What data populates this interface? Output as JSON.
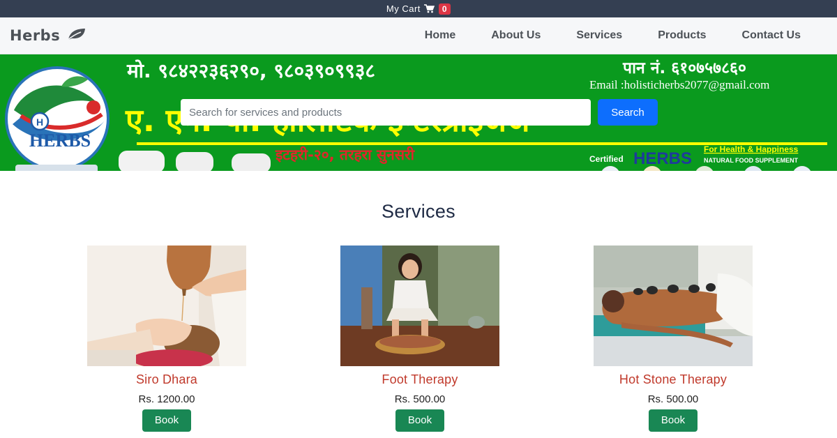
{
  "topbar": {
    "cart_label": "My Cart",
    "cart_count": "0"
  },
  "brand": {
    "name": "Herbs",
    "icon": "leaf-icon"
  },
  "nav": {
    "items": [
      {
        "label": "Home"
      },
      {
        "label": "About Us"
      },
      {
        "label": "Services"
      },
      {
        "label": "Products"
      },
      {
        "label": "Contact Us"
      }
    ]
  },
  "banner": {
    "phone": "मो. ९८४२२३६२९०, ९८०३९०९९३८",
    "pan": "पान नं. ६१०७५७८६०",
    "email": "Email :holisticherbs2077@gmail.com",
    "company": "ए. एन. पी. होलिष्टिक इन्टरप्राईजेज",
    "address": "इटहरी-२०, तरहरा सुनसरी",
    "logo_text": "HERBS",
    "logo_mark": "H",
    "certified": "Certified",
    "cert_brand": "HERBS",
    "tagline": "For Health & Happiness",
    "subtagline": "NATURAL FOOD SUPPLEMENT"
  },
  "search": {
    "placeholder": "Search for services and products",
    "button_label": "Search"
  },
  "services": {
    "title": "Services",
    "items": [
      {
        "name": "Siro Dhara",
        "price": "Rs. 1200.00",
        "button": "Book"
      },
      {
        "name": "Foot Therapy",
        "price": "Rs. 500.00",
        "button": "Book"
      },
      {
        "name": "Hot Stone Therapy",
        "price": "Rs. 500.00",
        "button": "Book"
      }
    ]
  },
  "colors": {
    "topbar": "#343f52",
    "banner_green": "#0a9a1e",
    "banner_yellow": "#ffff00",
    "service_name": "#c0392b",
    "book_button": "#198754",
    "search_button": "#0d6efd"
  }
}
